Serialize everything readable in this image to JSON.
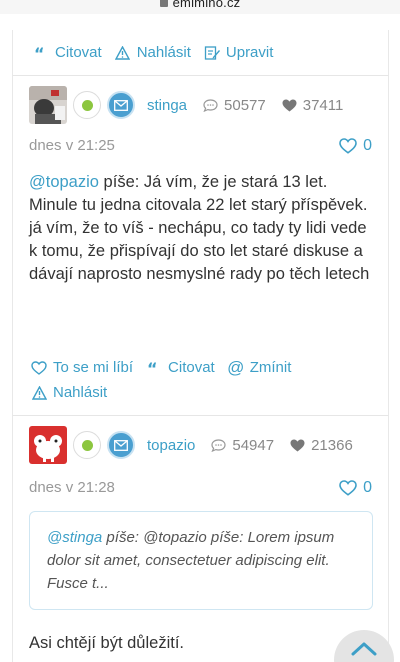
{
  "browser": {
    "url": "emimino.cz"
  },
  "post1": {
    "actions": {
      "quote": "Citovat",
      "report": "Nahlásit",
      "edit": "Upravit"
    }
  },
  "post2": {
    "user": "stinga",
    "comments": "50577",
    "hearts": "37411",
    "date": "dnes v 21:25",
    "likes": "0",
    "mention": "@topazio",
    "text": " píše: Já vím, že je stará 13 let. Minule tu jedna citovala 22 let starý příspěvek.",
    "text2": "já vím, že to víš - nechápu, co tady ty lidi vede k tomu, že přispívají do sto let staré diskuse a dávají naprosto nesmyslné rady po těch letech",
    "actions": {
      "like": "To se mi líbí",
      "quote": "Citovat",
      "mention": "Zmínit",
      "report": "Nahlásit"
    }
  },
  "post3": {
    "user": "topazio",
    "comments": "54947",
    "hearts": "21366",
    "date": "dnes v 21:28",
    "likes": "0",
    "quote": {
      "mention": "@stinga",
      "text": " píše: @topazio píše: Lorem ipsum dolor sit amet, consectetuer adipiscing elit. Fusce t..."
    },
    "text": "Asi chtějí být důležití."
  },
  "colors": {
    "accent": "#3d9fc7",
    "online": "#8cc63f",
    "mail": "#4a9fd0"
  },
  "icons": [
    "lock-icon",
    "quote-icon",
    "warning-icon",
    "edit-icon",
    "online-status-icon",
    "mail-icon",
    "comment-bubble-icon",
    "heart-icon",
    "heart-outline-icon",
    "at-icon",
    "chevron-up-icon"
  ]
}
